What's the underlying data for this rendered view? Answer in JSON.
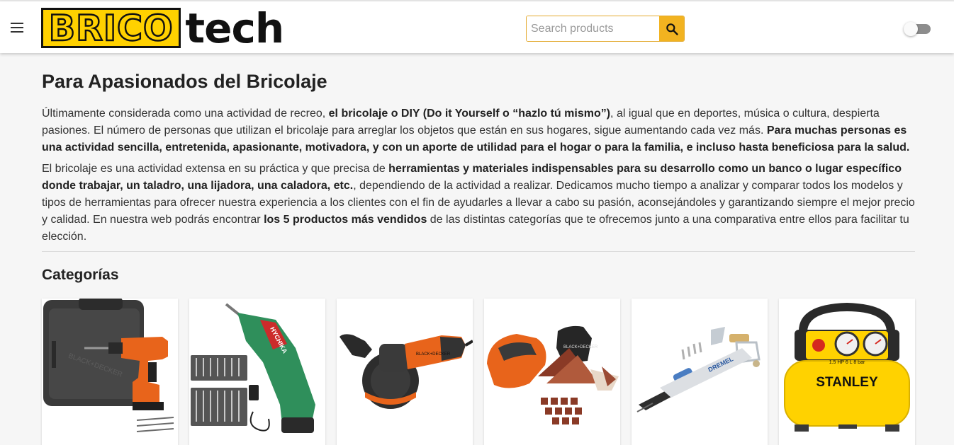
{
  "header": {
    "logo": {
      "part1": "BRICO",
      "part2": "tech"
    },
    "search": {
      "placeholder": "Search products"
    }
  },
  "main": {
    "title": "Para Apasionados del Bricolaje",
    "p1": {
      "t1": "Últimamente considerada como una actividad de recreo, ",
      "b1": "el bricolaje o DIY (Do it Yourself o “hazlo tú mismo”)",
      "t2": ", al igual que en deportes, música o cultura, despierta pasiones. El número de personas que utilizan el bricolaje para arreglar los objetos que están en sus hogares, sigue aumentando cada vez más. ",
      "b2": "Para muchas personas es una actividad sencilla, entretenida, apasionante, motivadora, y con un aporte de utilidad para el hogar o para la familia, e incluso hasta beneficiosa para la salud."
    },
    "p2": {
      "t1": "El bricolaje es una actividad extensa en su práctica y que precisa de ",
      "b1": "herramientas y materiales indispensables para su desarrollo como un banco o lugar específico donde trabajar, un taladro, una lijadora, una caladora, etc.",
      "t2": ", dependiendo de la actividad a realizar. Dedicamos mucho tiempo a analizar y comparar todos los modelos y tipos de herramientas para ofrecer nuestra experiencia a los clientes con el fin de ayudarles a llevar a cabo su pasión, aconsejándoles y garantizando siempre el mejor precio y calidad. En nuestra web podrás encontrar ",
      "b2": "los 5 productos más vendidos",
      "t3": " de las distintas categorías que te ofrecemos junto a una comparativa entre ellos para facilitar tu elección."
    },
    "categories_title": "Categorías",
    "card_texts": {
      "drill_case_brand": "BLACK+DECKER",
      "screwdriver_brand": "HYCHIKA",
      "grinder_brand": "BLACK+DECKER",
      "sander_brand": "BLACK+DECKER",
      "soldering_brand": "DREMEL",
      "compressor_brand": "STANLEY",
      "compressor_spec": "1.5 HP  6 L  8 bar"
    }
  },
  "colors": {
    "brand_yellow": "#ffd100",
    "search_button": "#f2b320",
    "search_border": "#e3a92d",
    "black_decker_orange": "#e8641b"
  },
  "icons": {
    "menu": "hamburger-menu-icon",
    "search": "search-icon",
    "theme_toggle": "toggle-switch"
  }
}
